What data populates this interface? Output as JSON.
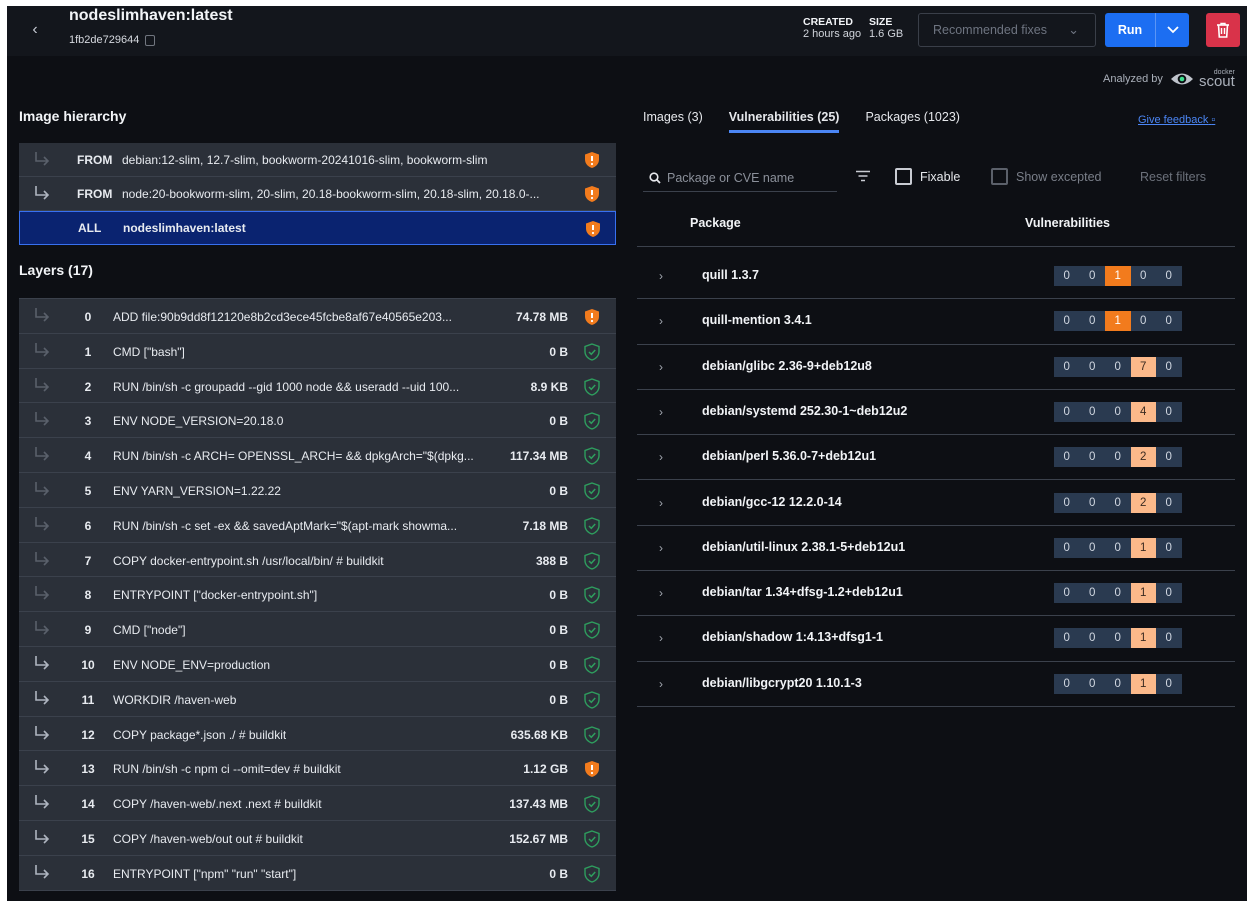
{
  "header": {
    "title": "nodeslimhaven:latest",
    "image_id": "1fb2de729644",
    "created_label": "CREATED",
    "created_value": "2 hours ago",
    "size_label": "SIZE",
    "size_value": "1.6 GB",
    "recommended_fixes": "Recommended fixes",
    "run_label": "Run"
  },
  "analyzed": {
    "label": "Analyzed by",
    "brand_small": "docker",
    "brand": "scout"
  },
  "hierarchy": {
    "title": "Image hierarchy",
    "rows": [
      {
        "kind": "FROM",
        "text": "debian:12-slim, 12.7-slim, bookworm-20241016-slim, bookworm-slim"
      },
      {
        "kind": "FROM",
        "text": "node:20-bookworm-slim, 20-slim, 20.18-bookworm-slim, 20.18-slim, 20.18.0-..."
      },
      {
        "kind": "ALL",
        "text": "nodeslimhaven:latest"
      }
    ]
  },
  "layers": {
    "title": "Layers (17)",
    "rows": [
      {
        "idx": "0",
        "cmd": "ADD file:90b9dd8f12120e8b2cd3ece45fcbe8af67e40565e203...",
        "size": "74.78 MB",
        "status": "warn"
      },
      {
        "idx": "1",
        "cmd": "CMD [\"bash\"]",
        "size": "0 B",
        "status": "ok"
      },
      {
        "idx": "2",
        "cmd": "RUN /bin/sh -c groupadd --gid 1000 node && useradd --uid 100...",
        "size": "8.9 KB",
        "status": "ok"
      },
      {
        "idx": "3",
        "cmd": "ENV NODE_VERSION=20.18.0",
        "size": "0 B",
        "status": "ok"
      },
      {
        "idx": "4",
        "cmd": "RUN /bin/sh -c ARCH= OPENSSL_ARCH= && dpkgArch=\"$(dpkg...",
        "size": "117.34 MB",
        "status": "ok"
      },
      {
        "idx": "5",
        "cmd": "ENV YARN_VERSION=1.22.22",
        "size": "0 B",
        "status": "ok"
      },
      {
        "idx": "6",
        "cmd": "RUN /bin/sh -c set -ex && savedAptMark=\"$(apt-mark showma...",
        "size": "7.18 MB",
        "status": "ok"
      },
      {
        "idx": "7",
        "cmd": "COPY docker-entrypoint.sh /usr/local/bin/ # buildkit",
        "size": "388 B",
        "status": "ok"
      },
      {
        "idx": "8",
        "cmd": "ENTRYPOINT [\"docker-entrypoint.sh\"]",
        "size": "0 B",
        "status": "ok"
      },
      {
        "idx": "9",
        "cmd": "CMD [\"node\"]",
        "size": "0 B",
        "status": "ok"
      },
      {
        "idx": "10",
        "cmd": "ENV NODE_ENV=production",
        "size": "0 B",
        "status": "ok"
      },
      {
        "idx": "11",
        "cmd": "WORKDIR /haven-web",
        "size": "0 B",
        "status": "ok"
      },
      {
        "idx": "12",
        "cmd": "COPY package*.json ./ # buildkit",
        "size": "635.68 KB",
        "status": "ok"
      },
      {
        "idx": "13",
        "cmd": "RUN /bin/sh -c npm ci --omit=dev # buildkit",
        "size": "1.12 GB",
        "status": "warn"
      },
      {
        "idx": "14",
        "cmd": "COPY /haven-web/.next .next # buildkit",
        "size": "137.43 MB",
        "status": "ok"
      },
      {
        "idx": "15",
        "cmd": "COPY /haven-web/out out # buildkit",
        "size": "152.67 MB",
        "status": "ok"
      },
      {
        "idx": "16",
        "cmd": "ENTRYPOINT [\"npm\" \"run\" \"start\"]",
        "size": "0 B",
        "status": "ok"
      }
    ]
  },
  "tabs": [
    {
      "label": "Images (3)"
    },
    {
      "label": "Vulnerabilities (25)"
    },
    {
      "label": "Packages (1023)"
    }
  ],
  "feedback": "Give feedback",
  "filters": {
    "search_placeholder": "Package or CVE name",
    "fixable": "Fixable",
    "show_excepted": "Show excepted",
    "reset": "Reset filters"
  },
  "table": {
    "col_package": "Package",
    "col_vulns": "Vulnerabilities",
    "rows": [
      {
        "name": "quill 1.3.7",
        "counts": [
          "0",
          "0",
          "1",
          "0",
          "0"
        ]
      },
      {
        "name": "quill-mention 3.4.1",
        "counts": [
          "0",
          "0",
          "1",
          "0",
          "0"
        ]
      },
      {
        "name": "debian/glibc 2.36-9+deb12u8",
        "counts": [
          "0",
          "0",
          "0",
          "7",
          "0"
        ]
      },
      {
        "name": "debian/systemd 252.30-1~deb12u2",
        "counts": [
          "0",
          "0",
          "0",
          "4",
          "0"
        ]
      },
      {
        "name": "debian/perl 5.36.0-7+deb12u1",
        "counts": [
          "0",
          "0",
          "0",
          "2",
          "0"
        ]
      },
      {
        "name": "debian/gcc-12 12.2.0-14",
        "counts": [
          "0",
          "0",
          "0",
          "2",
          "0"
        ]
      },
      {
        "name": "debian/util-linux 2.38.1-5+deb12u1",
        "counts": [
          "0",
          "0",
          "0",
          "1",
          "0"
        ]
      },
      {
        "name": "debian/tar 1.34+dfsg-1.2+deb12u1",
        "counts": [
          "0",
          "0",
          "0",
          "1",
          "0"
        ]
      },
      {
        "name": "debian/shadow 1:4.13+dfsg1-1",
        "counts": [
          "0",
          "0",
          "0",
          "1",
          "0"
        ]
      },
      {
        "name": "debian/libgcrypt20 1.10.1-3",
        "counts": [
          "0",
          "0",
          "0",
          "1",
          "0"
        ]
      }
    ]
  },
  "colors": {
    "accent": "#1c6ef2",
    "warn": "#f27b1d",
    "ok": "#2e9e5e",
    "medium": "#f27b1d",
    "low": "#fbb98a",
    "delete": "#d9334a"
  }
}
